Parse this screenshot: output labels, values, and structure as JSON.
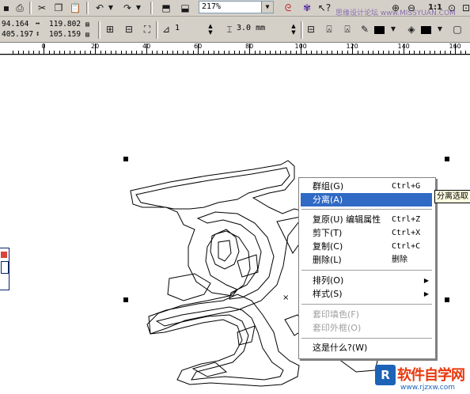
{
  "toolbar": {
    "zoom_value": "217%",
    "watermark_text": "思缘设计论坛 www.MISSYUAN.COM"
  },
  "property_bar": {
    "x": "94.164",
    "y": "405.197",
    "width": "119.802",
    "height": "105.159",
    "rotation": "1",
    "outline_width": "3.0 mm"
  },
  "ruler": {
    "labels": [
      "0",
      "20",
      "40",
      "60",
      "80",
      "100",
      "120",
      "140",
      "160"
    ]
  },
  "context_menu": {
    "items": [
      {
        "label": "群组(G)",
        "shortcut": "Ctrl+G"
      },
      {
        "label": "分离(A)",
        "selected": true
      },
      {
        "label": "复原(U) 编辑属性",
        "shortcut": "Ctrl+Z"
      },
      {
        "label": "剪下(T)",
        "shortcut": "Ctrl+X"
      },
      {
        "label": "复制(C)",
        "shortcut": "Ctrl+C"
      },
      {
        "label": "删除(L)",
        "shortcut": "删除"
      },
      {
        "label": "排列(O)",
        "submenu": true
      },
      {
        "label": "样式(S)",
        "submenu": true
      },
      {
        "label": "套印填色(F)",
        "disabled": true
      },
      {
        "label": "套印外框(O)",
        "disabled": true
      },
      {
        "label": "这是什么?(W)"
      }
    ]
  },
  "tooltip": "分离选取",
  "site_watermark": {
    "logo": "R",
    "name": "软件自学网",
    "url": "www.rjzxw.com"
  },
  "colors": {
    "chrome": "#d4d0c8",
    "menu_highlight": "#316ac5",
    "tooltip_bg": "#ffffe1"
  }
}
